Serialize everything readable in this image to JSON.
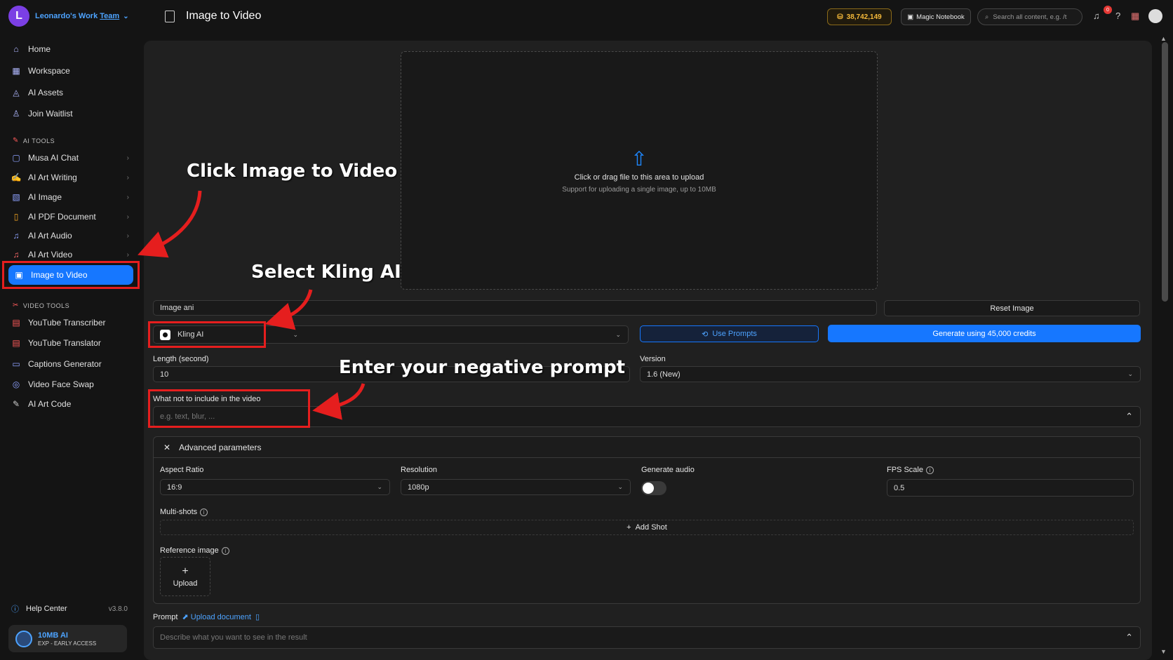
{
  "team": {
    "initial": "L",
    "name_prefix": "Leonardo's Work",
    "name_suffix": "Team"
  },
  "nav": {
    "main": [
      {
        "label": "Home",
        "icon": "home-icon"
      },
      {
        "label": "Workspace",
        "icon": "workspace-icon"
      },
      {
        "label": "AI Assets",
        "icon": "assets-icon"
      },
      {
        "label": "Join Waitlist",
        "icon": "waitlist-icon"
      }
    ],
    "ai_tools_title": "AI TOOLS",
    "ai_tools": [
      {
        "label": "Musa AI Chat"
      },
      {
        "label": "AI Art Writing"
      },
      {
        "label": "AI Image"
      },
      {
        "label": "AI PDF Document"
      },
      {
        "label": "AI Art Audio"
      },
      {
        "label": "AI Art Video"
      }
    ],
    "active_item": "Image to Video",
    "video_tools_title": "VIDEO TOOLS",
    "video_tools": [
      {
        "label": "YouTube Transcriber"
      },
      {
        "label": "YouTube Translator"
      },
      {
        "label": "Captions Generator"
      },
      {
        "label": "Video Face Swap"
      },
      {
        "label": "AI Art Code"
      }
    ],
    "help": "Help Center",
    "version": "v3.8.0"
  },
  "profile": {
    "name": "10MB AI",
    "sub": "EXP - EARLY ACCESS"
  },
  "header": {
    "title": "Image to Video",
    "credits": "38,742,149",
    "magic_notebook": "Magic Notebook",
    "search_placeholder": "Search all content, e.g. /t",
    "notification_count": "0"
  },
  "upload": {
    "line1": "Click or drag file to this area to upload",
    "line2": "Support for uploading a single image, up to 10MB"
  },
  "form": {
    "image_name": "Image ani",
    "reset_image": "Reset Image",
    "model": "Kling AI",
    "use_prompts": "Use Prompts",
    "generate": "Generate using 45,000 credits",
    "length_label": "Length (second)",
    "length_value": "10",
    "version_label": "Version",
    "version_value": "1.6 (New)",
    "negative_label": "What not to include in the video",
    "negative_placeholder": "e.g. text, blur, ...",
    "advanced_title": "Advanced parameters",
    "aspect_label": "Aspect Ratio",
    "aspect_value": "16:9",
    "resolution_label": "Resolution",
    "resolution_value": "1080p",
    "audio_label": "Generate audio",
    "audio_on": false,
    "fps_label": "FPS Scale",
    "fps_value": "0.5",
    "multishots_label": "Multi-shots",
    "add_shot": "Add Shot",
    "reference_label": "Reference image",
    "upload_label": "Upload",
    "prompt_label": "Prompt",
    "upload_document": "Upload document",
    "prompt_placeholder": "Describe what you want to see in the result"
  },
  "annotations": {
    "a1": "Click Image to Video",
    "a2": "Select Kling AI",
    "a3": "Enter your negative prompt",
    "color": "#e51e1e"
  },
  "colors": {
    "accent": "#1677ff",
    "credits": "#f5b93a",
    "background": "#141414",
    "panel": "#202020"
  }
}
